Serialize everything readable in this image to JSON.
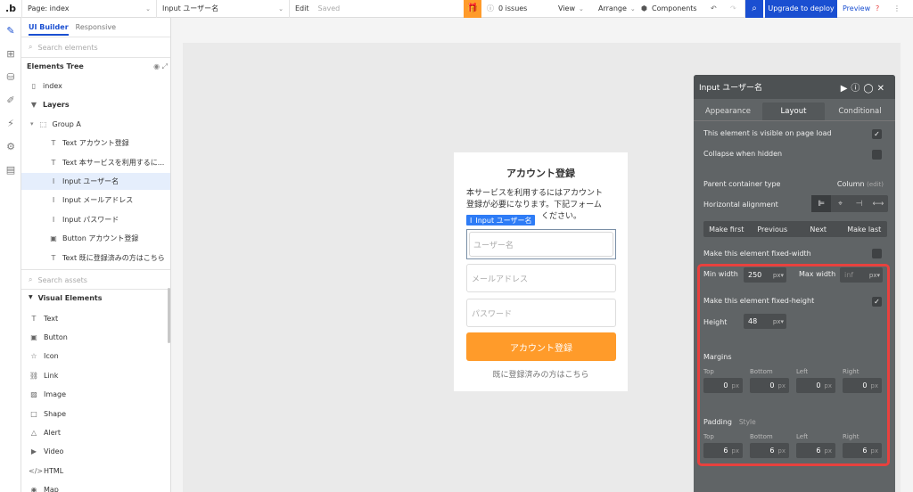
{
  "topbar": {
    "logo": ".b",
    "page_label": "Page: index",
    "element_label": "Input ユーザー名",
    "edit": "Edit",
    "saved": "Saved",
    "issues": "0 issues",
    "view": "View",
    "arrange": "Arrange",
    "components": "Components",
    "upgrade": "Upgrade to deploy",
    "preview": "Preview"
  },
  "sidebar": {
    "tab_builder": "UI Builder",
    "tab_responsive": "Responsive",
    "search_elements": "Search elements",
    "tree_title": "Elements Tree",
    "tree": [
      {
        "label": "index",
        "level": 0,
        "icon": "page-icon"
      },
      {
        "label": "Layers",
        "level": 0,
        "icon": "caret-down-icon",
        "bold": true
      },
      {
        "label": "Group A",
        "level": 1,
        "icon": "group-icon"
      },
      {
        "label": "Text アカウント登録",
        "level": 2,
        "icon": "text-icon"
      },
      {
        "label": "Text 本サービスを利用するに...",
        "level": 2,
        "icon": "text-icon"
      },
      {
        "label": "Input ユーザー名",
        "level": 2,
        "icon": "input-icon",
        "selected": true
      },
      {
        "label": "Input メールアドレス",
        "level": 2,
        "icon": "input-icon"
      },
      {
        "label": "Input パスワード",
        "level": 2,
        "icon": "input-icon"
      },
      {
        "label": "Button アカウント登録",
        "level": 2,
        "icon": "button-icon"
      },
      {
        "label": "Text 既に登録済みの方はこちら",
        "level": 2,
        "icon": "text-icon"
      }
    ],
    "search_assets": "Search assets",
    "visual_title": "Visual Elements",
    "visual": [
      {
        "label": "Text",
        "icon": "text-icon",
        "glyph": "T"
      },
      {
        "label": "Button",
        "icon": "button-icon",
        "glyph": "▣"
      },
      {
        "label": "Icon",
        "icon": "star-icon",
        "glyph": "☆"
      },
      {
        "label": "Link",
        "icon": "link-icon",
        "glyph": "⛓"
      },
      {
        "label": "Image",
        "icon": "image-icon",
        "glyph": "▨"
      },
      {
        "label": "Shape",
        "icon": "shape-icon",
        "glyph": "□"
      },
      {
        "label": "Alert",
        "icon": "alert-icon",
        "glyph": "△"
      },
      {
        "label": "Video",
        "icon": "video-icon",
        "glyph": "▶"
      },
      {
        "label": "HTML",
        "icon": "html-icon",
        "glyph": "</>"
      },
      {
        "label": "Map",
        "icon": "map-icon",
        "glyph": "◉"
      }
    ]
  },
  "form": {
    "title": "アカウント登録",
    "desc_1": "本サービスを利用するにはアカウント",
    "desc_2": "登録が必要になります。下記フォーム",
    "desc_3": "ください。",
    "selected_tag": "Input ユーザー名",
    "username_ph": "ユーザー名",
    "email_ph": "メールアドレス",
    "password_ph": "パスワード",
    "submit": "アカウント登録",
    "login_link": "既に登録済みの方はこちら"
  },
  "panel": {
    "title": "Input ユーザー名",
    "tabs": [
      "Appearance",
      "Layout",
      "Conditional"
    ],
    "visible_on_load": "This element is visible on page load",
    "collapse_hidden": "Collapse when hidden",
    "parent_type_label": "Parent container type",
    "parent_type_value": "Column",
    "parent_type_edit": "(edit)",
    "h_align": "Horizontal alignment",
    "order_buttons": [
      "Make first",
      "Previous",
      "Next",
      "Make last"
    ],
    "fixed_width": "Make this element fixed-width",
    "min_width_label": "Min width",
    "min_width": "250",
    "max_width_label": "Max width",
    "max_width": "inf",
    "unit": "px",
    "fixed_height": "Make this element fixed-height",
    "height_label": "Height",
    "height": "48",
    "margins_title": "Margins",
    "padding_title": "Padding",
    "style_label": "Style",
    "sides": [
      "Top",
      "Bottom",
      "Left",
      "Right"
    ],
    "margins": [
      "0",
      "0",
      "0",
      "0"
    ],
    "padding": [
      "6",
      "6",
      "6",
      "6"
    ]
  },
  "colors": {
    "accent": "#ff9b2a",
    "blue": "#1a4fd1",
    "highlight": "#e8413e",
    "panel": "#606466"
  }
}
